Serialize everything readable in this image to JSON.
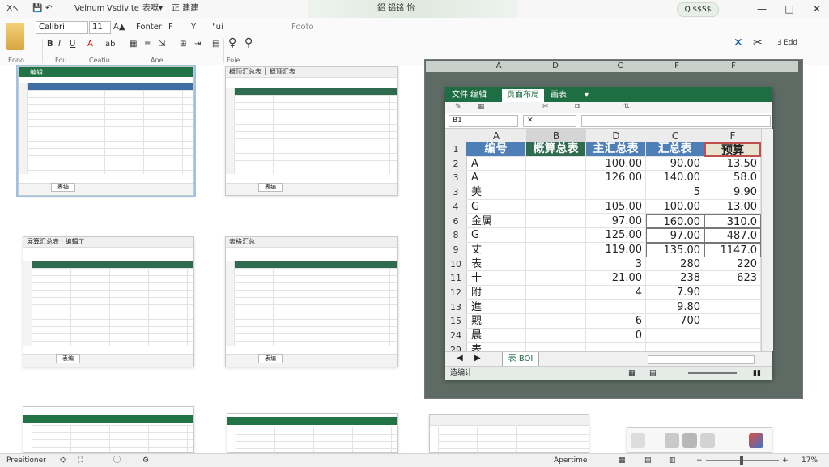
{
  "titlebar": {
    "quick": [
      "Ⅸ↖",
      "Velnum",
      "Vsdivite",
      "表嘅▾",
      "正 建建"
    ],
    "title": "鋁 铝铭 怡",
    "search": "Q $$S$",
    "window_buttons": [
      "—",
      "□",
      "✕"
    ]
  },
  "ribbon": {
    "font_name": "Calibri",
    "font_size": "11",
    "row1": [
      "Fonter",
      "F",
      "Y",
      "\"ui",
      "Footo"
    ],
    "row2": [
      "B",
      "I",
      "U",
      "A",
      "ab"
    ],
    "groups": [
      "Eono",
      "Fou",
      "Ceatiu",
      "Ane",
      "Fuie"
    ],
    "right_icons": [
      "✕",
      "✂",
      "Ⅎ Edd"
    ]
  },
  "thumbnails": [
    {
      "title": "编辑",
      "tab": "表编"
    },
    {
      "title": "概顶汇总表 │ 概顶汇表",
      "tab": "表编"
    },
    {
      "title": "展算汇总表 · 编辑了",
      "tab": "表编"
    },
    {
      "title": "表格汇总",
      "tab": "表编"
    },
    {
      "title": "",
      "tab": ""
    },
    {
      "title": "",
      "tab": ""
    },
    {
      "title": "",
      "tab": ""
    }
  ],
  "main": {
    "outer_columns": [
      "A",
      "D",
      "C",
      "F",
      "F"
    ],
    "tabs": [
      "文件 编辑",
      "页面布局",
      "画表",
      "▾"
    ],
    "name_box": "B1",
    "fx": "✕",
    "columns": [
      "A",
      "B",
      "D",
      "C",
      "F"
    ],
    "headers": [
      "编号",
      "概算总表",
      "主汇总表",
      "汇总表",
      "预算"
    ],
    "rows": [
      {
        "num": "1"
      },
      {
        "num": "2",
        "a": "A",
        "d": "100.00",
        "c": "90.00",
        "f": "13.50"
      },
      {
        "num": "3",
        "a": "A",
        "d": "126.00",
        "c": "140.00",
        "f": "58.0"
      },
      {
        "num": "3",
        "a": "美",
        "d": "",
        "c": "5",
        "f": "9.90"
      },
      {
        "num": "4",
        "a": "G",
        "d": "105.00",
        "c": "100.00",
        "f": "13.00"
      },
      {
        "num": "6",
        "a": "金属",
        "d": "97.00",
        "c": "160.00",
        "f": "310.0"
      },
      {
        "num": "8",
        "a": "G",
        "d": "125.00",
        "c": "97.00",
        "f": "487.0"
      },
      {
        "num": "9",
        "a": "丈",
        "d": "119.00",
        "c": "135.00",
        "f": "1147.0"
      },
      {
        "num": "10",
        "a": "表",
        "d": "3",
        "c": "280",
        "f": "220"
      },
      {
        "num": "11",
        "a": "十",
        "d": "21.00",
        "c": "238",
        "f": "623"
      },
      {
        "num": "12",
        "a": "附",
        "d": "4",
        "c": "7.90",
        "f": ""
      },
      {
        "num": "13",
        "a": "進",
        "d": "",
        "c": "9.80",
        "f": ""
      },
      {
        "num": "15",
        "a": "覭",
        "d": "6",
        "c": "700",
        "f": ""
      },
      {
        "num": "24",
        "a": "晨",
        "d": "0",
        "c": "",
        "f": ""
      },
      {
        "num": "29",
        "a": "表",
        "d": "",
        "c": "",
        "f": ""
      }
    ],
    "sheet_tab": "表 BOI",
    "status_left": "造编计"
  },
  "statusbar": {
    "left": "Preeitioner",
    "mid": "Apertime",
    "zoom": "17%"
  },
  "colors": {
    "accent": "#217346",
    "header_blue": "#4e7fb6",
    "header_green": "#2f6b4f"
  }
}
